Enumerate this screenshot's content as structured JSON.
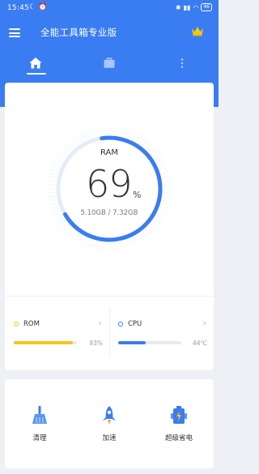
{
  "status_bar": {
    "time": "15:45",
    "battery": "46"
  },
  "app": {
    "title": "全能工具箱专业版"
  },
  "tabs": [
    {
      "icon": "home-icon"
    },
    {
      "icon": "briefcase-icon"
    },
    {
      "icon": "more-vertical-icon"
    }
  ],
  "ram": {
    "label": "RAM",
    "value": "69",
    "unit": "%",
    "usage": "5.10GB / 7.32GB",
    "percent": 69
  },
  "stats": {
    "rom": {
      "label": "ROM",
      "value": "93%",
      "percent": 93,
      "color": "#f5c518"
    },
    "cpu": {
      "label": "CPU",
      "value": "44℃",
      "percent": 44,
      "color": "#3a7cf2"
    }
  },
  "tools": [
    {
      "label": "清理",
      "icon": "broom-icon"
    },
    {
      "label": "加速",
      "icon": "rocket-icon"
    },
    {
      "label": "超级省电",
      "icon": "battery-robot-icon"
    }
  ],
  "colors": {
    "primary": "#3a7cf2",
    "accent": "#f5c518"
  }
}
